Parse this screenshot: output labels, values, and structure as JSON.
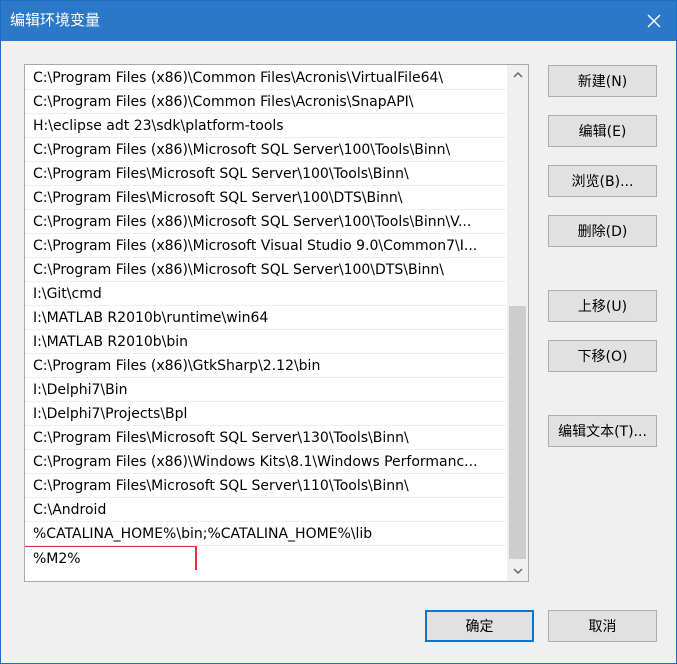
{
  "window": {
    "title": "编辑环境变量"
  },
  "paths": [
    "C:\\Program Files (x86)\\Common Files\\Acronis\\VirtualFile64\\",
    "C:\\Program Files (x86)\\Common Files\\Acronis\\SnapAPI\\",
    "H:\\eclipse adt 23\\sdk\\platform-tools",
    "C:\\Program Files (x86)\\Microsoft SQL Server\\100\\Tools\\Binn\\",
    "C:\\Program Files\\Microsoft SQL Server\\100\\Tools\\Binn\\",
    "C:\\Program Files\\Microsoft SQL Server\\100\\DTS\\Binn\\",
    "C:\\Program Files (x86)\\Microsoft SQL Server\\100\\Tools\\Binn\\V...",
    "C:\\Program Files (x86)\\Microsoft Visual Studio 9.0\\Common7\\I...",
    "C:\\Program Files (x86)\\Microsoft SQL Server\\100\\DTS\\Binn\\",
    "I:\\Git\\cmd",
    "I:\\MATLAB R2010b\\runtime\\win64",
    "I:\\MATLAB R2010b\\bin",
    "C:\\Program Files (x86)\\GtkSharp\\2.12\\bin",
    "I:\\Delphi7\\Bin",
    "I:\\Delphi7\\Projects\\Bpl",
    "C:\\Program Files\\Microsoft SQL Server\\130\\Tools\\Binn\\",
    "C:\\Program Files (x86)\\Windows Kits\\8.1\\Windows Performanc...",
    "C:\\Program Files\\Microsoft SQL Server\\110\\Tools\\Binn\\",
    "C:\\Android",
    "%CATALINA_HOME%\\bin;%CATALINA_HOME%\\lib"
  ],
  "editing_value": "%M2%",
  "buttons": {
    "new": "新建(N)",
    "edit": "编辑(E)",
    "browse": "浏览(B)...",
    "delete": "删除(D)",
    "move_up": "上移(U)",
    "move_down": "下移(O)",
    "edit_text": "编辑文本(T)...",
    "ok": "确定",
    "cancel": "取消"
  },
  "icons": {
    "close": "close-icon",
    "scroll_up": "chevron-up-icon",
    "scroll_down": "chevron-down-icon"
  },
  "colors": {
    "titlebar": "#2b78c9",
    "highlight": "#e3323e",
    "primary_border": "#0078d7"
  }
}
